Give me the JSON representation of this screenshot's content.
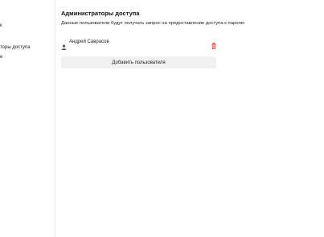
{
  "sidebar": {
    "items": [
      {
        "label": "к"
      },
      {
        "label": "торы доступа"
      },
      {
        "label": "е"
      }
    ]
  },
  "main": {
    "title": "Администраторы доступа",
    "description": "Данные пользователи будут получать запрос на предоставление доступа к паролю",
    "users": [
      {
        "name": "Андрей Саврасов",
        "icon": "user-icon",
        "action_icon": "trash-icon"
      }
    ],
    "add_button_label": "Добавить пользователя"
  },
  "colors": {
    "danger": "#e23b3b",
    "button_bg": "#f1f1f1",
    "divider": "#ececec"
  }
}
